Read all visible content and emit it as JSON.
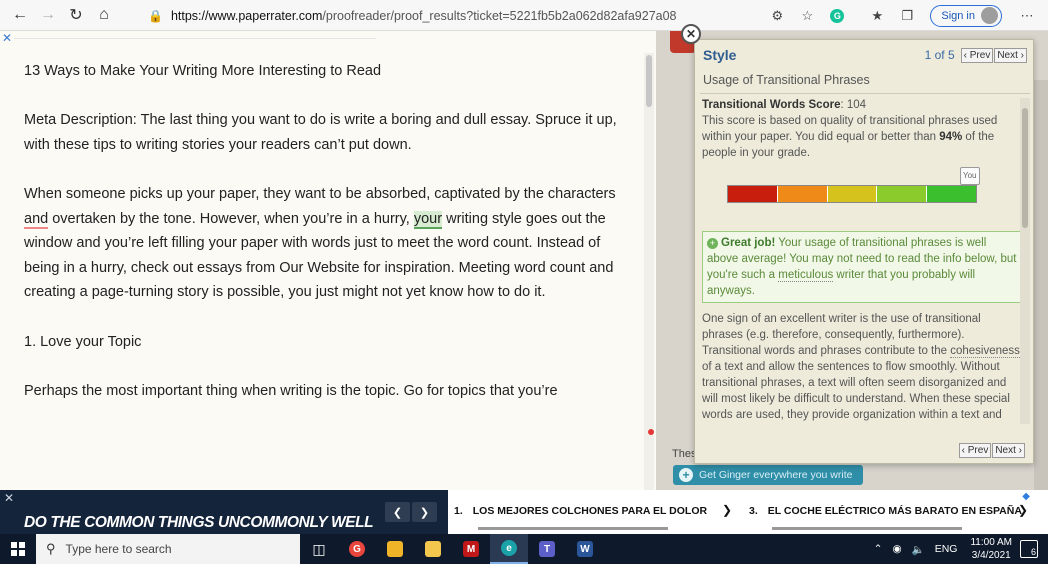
{
  "browser": {
    "url_host": "https://www.paperrater.com",
    "url_path": "/proofreader/proof_results?ticket=5221fb5b2a062d82afa927a08",
    "signin_label": "Sign in"
  },
  "document": {
    "title": "13 Ways to Make Your Writing More Interesting to Read",
    "meta": "Meta Description: The last thing you want to do is write a boring and dull essay. Spruce it up, with these tips to writing stories your readers can’t put down.",
    "p1_before_and": "When someone picks up your paper, they want to be absorbed, captivated by the characters ",
    "p1_and": "and",
    "p1_mid": " overtaken by the tone. However, when you’re in a hurry, ",
    "p1_your": "your",
    "p1_after": " writing style goes out the window and you’re left filling your paper with words just to meet the word count. Instead of being in a hurry, check out essays from Our Website for inspiration. Meeting word count and creating a page-turning story is possible, you just might not yet know how to do it.",
    "heading1": "1. Love your Topic",
    "p2": "Perhaps the most important thing when writing is the topic. Go for topics that you’re"
  },
  "popup": {
    "title": "Style",
    "count": "1 of 5",
    "prev": "‹ Prev",
    "next": "Next ›",
    "subtitle": "Usage of Transitional Phrases",
    "score_label": "Transitional Words Score",
    "score_value": ": 104",
    "score_desc_1": "This score is based on quality of transitional phrases used within your paper. You did equal or better than ",
    "score_pct": "94%",
    "score_desc_2": " of the people in your grade.",
    "you_tag": "You",
    "bar_colors": [
      "#c81e0e",
      "#ef8a18",
      "#d6c21c",
      "#8ccb2c",
      "#3bbf2e"
    ],
    "great_title": "Great job!",
    "great_text_1": " Your usage of transitional phrases is well above average! You may not need to read the info below, but you're such a ",
    "great_word": "meticulous",
    "great_text_2": " writer that you probably will anyways.",
    "expl_1": "One sign of an excellent writer is the use of transitional phrases (e.g. therefore, consequently, furthermore). Transitional words and phrases contribute to the ",
    "expl_word": "cohesiveness",
    "expl_2": " of a text and allow the sentences to flow smoothly. Without transitional phrases, a text will often seem disorganized and will most likely be difficult to understand. When these special words are used, they provide organization within a text and lead to greater",
    "foot_prev": "‹ Prev",
    "foot_next": "Next ›"
  },
  "side": {
    "thes": "Thes",
    "ginger": "Get Ginger everywhere you write"
  },
  "ad": {
    "slogan": "DO THE COMMON THINGS UNCOMMONLY WELL",
    "item1_num": "1.",
    "item1": "LOS MEJORES COLCHONES PARA EL DOLOR",
    "item3_num": "3.",
    "item3": "EL COCHE ELÉCTRICO MÁS BARATO EN ESPAÑA"
  },
  "taskbar": {
    "search_placeholder": "Type here to search",
    "lang": "ENG",
    "time": "11:00 AM",
    "date": "3/4/2021",
    "notifications": "6"
  }
}
